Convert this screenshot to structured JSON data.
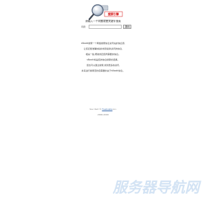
{
  "logo": {
    "brand_text": "搜索引擎",
    "brand_color": "#d10000",
    "icon": "magnifier-icon"
  },
  "search": {
    "prompt": "请输入一个问题或是关键字搜索",
    "prefix": "问题：",
    "placeholder": "",
    "button_label": "提问"
  },
  "description": [
    "sNooki搜索一个网络搜索信息资讯站的信息源,",
    "让您还能准确快捷的找到最新资讯的信息,",
    "相关一些,帮助找回您所需要的信息。",
    "sNooki将是您的信息搜索的选择。",
    "您也可以通过搜索,找到更多的资讯,",
    "并来进行搜索查找您需要的关于sNooki信息。"
  ],
  "footer": {
    "copyright_prefix": "Your Part ©",
    "copyright_link": "Freshslate",
    "copyright_suffix": "Inc.",
    "years": "2000-2020"
  },
  "watermark": {
    "text": "服务器导航网"
  }
}
